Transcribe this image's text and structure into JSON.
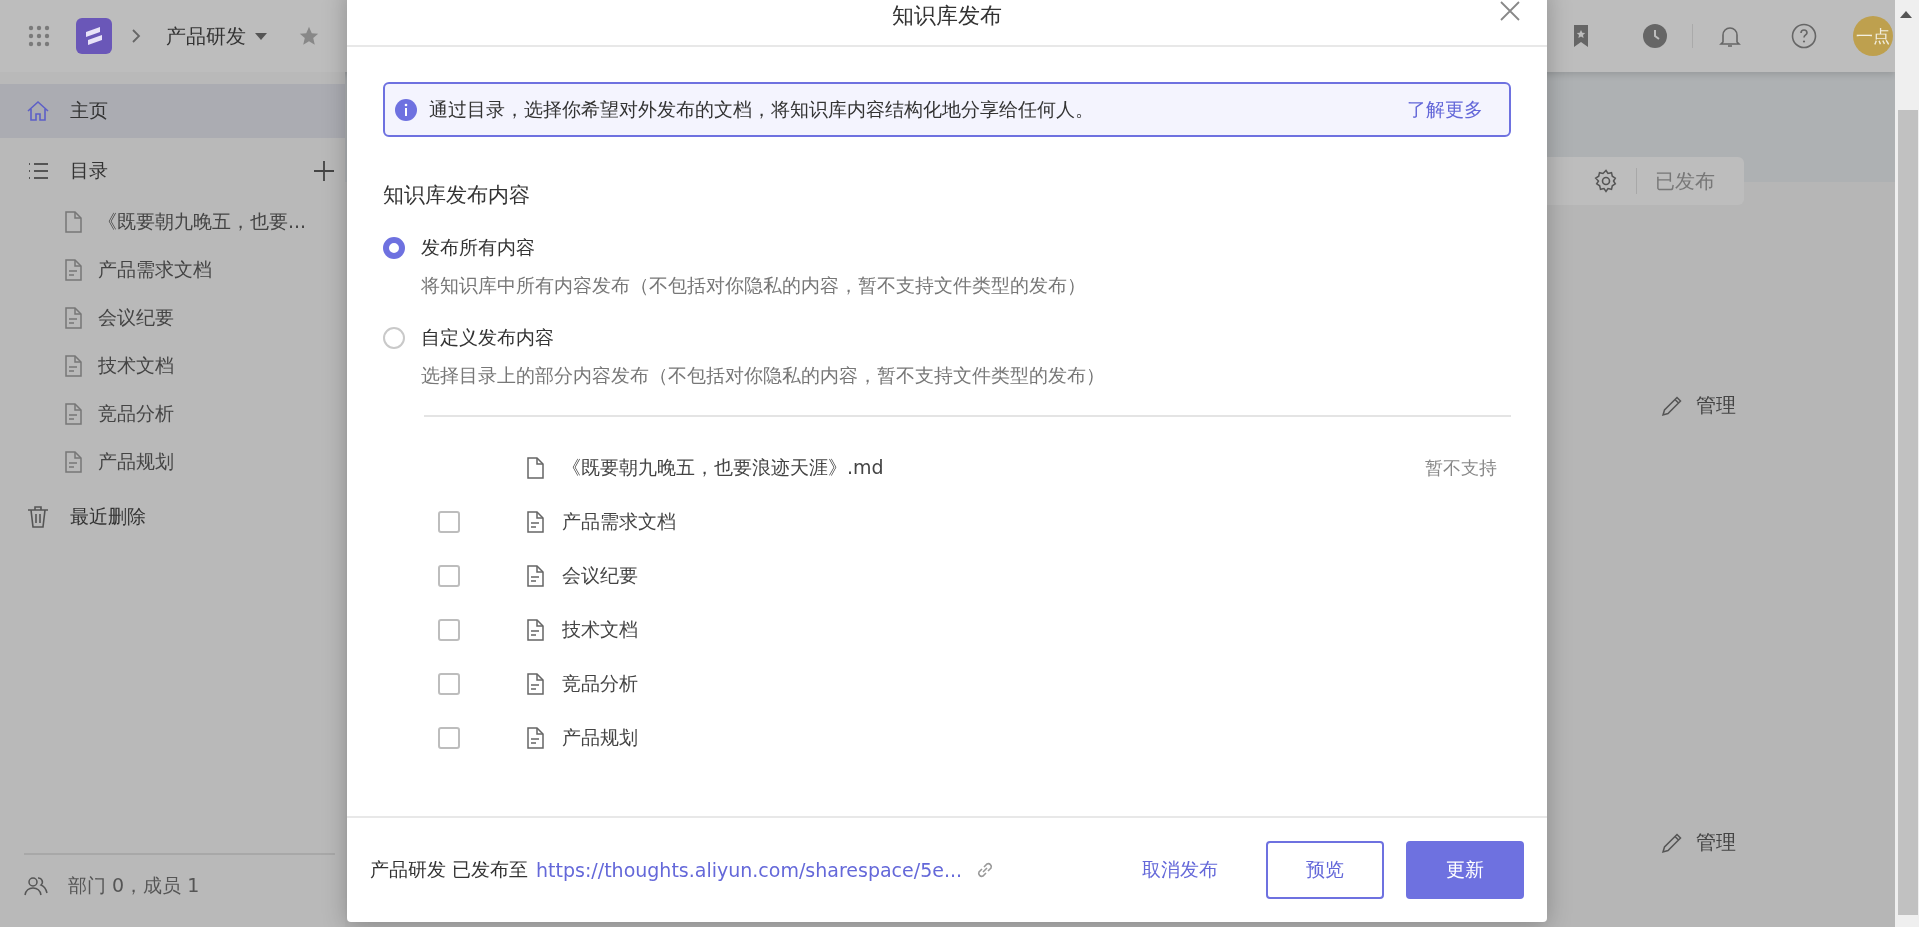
{
  "header": {
    "space": "产品研发",
    "avatar": "一点"
  },
  "sidebar": {
    "home": {
      "label": "主页",
      "selected": true
    },
    "catalog": {
      "label": "目录",
      "docs": [
        {
          "label": "《既要朝九晚五，也要...",
          "kind": "file"
        },
        {
          "label": "产品需求文档",
          "kind": "doc"
        },
        {
          "label": "会议纪要",
          "kind": "doc"
        },
        {
          "label": "技术文档",
          "kind": "doc"
        },
        {
          "label": "竞品分析",
          "kind": "doc"
        },
        {
          "label": "产品规划",
          "kind": "doc"
        }
      ]
    },
    "trash": "最近删除",
    "footer": "部门 0，成员 1"
  },
  "main": {
    "status": "已发布",
    "manage_links": [
      "管理",
      "管理"
    ]
  },
  "modal": {
    "title": "知识库发布",
    "info": {
      "text": "通过目录，选择你希望对外发布的文档，将知识库内容结构化地分享给任何人。",
      "link": "了解更多"
    },
    "section_title": "知识库发布内容",
    "options": [
      {
        "label": "发布所有内容",
        "description": "将知识库中所有内容发布（不包括对你隐私的内容，暂不支持文件类型的发布）",
        "selected": true
      },
      {
        "label": "自定义发布内容",
        "description": "选择目录上的部分内容发布（不包括对你隐私的内容，暂不支持文件类型的发布）",
        "selected": false
      }
    ],
    "docs": [
      {
        "name": "《既要朝九晚五，也要浪迹天涯》.md",
        "kind": "file",
        "note": "暂不支持"
      },
      {
        "name": "产品需求文档",
        "kind": "doc",
        "checked": false
      },
      {
        "name": "会议纪要",
        "kind": "doc",
        "checked": false
      },
      {
        "name": "技术文档",
        "kind": "doc",
        "checked": false
      },
      {
        "name": "竞品分析",
        "kind": "doc",
        "checked": false
      },
      {
        "name": "产品规划",
        "kind": "doc",
        "checked": false
      }
    ],
    "footer": {
      "space": "产品研发",
      "published_label": "已发布至",
      "url": "https://thoughts.aliyun.com/sharespace/5e...",
      "cancel": "取消发布",
      "preview": "预览",
      "update": "更新"
    }
  }
}
